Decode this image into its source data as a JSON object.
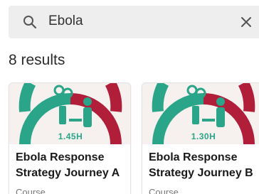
{
  "search": {
    "query": "Ebola",
    "search_icon": "search-icon",
    "clear_icon": "close-icon"
  },
  "results": {
    "count_label": "8 results"
  },
  "cards": [
    {
      "title": "Ebola Response Strategy Journey A",
      "duration": "1.45H",
      "type": "Course",
      "icon": "health-worker-illustration"
    },
    {
      "title": "Ebola Response Strategy Journey B",
      "duration": "1.30H",
      "type": "Course",
      "icon": "health-worker-illustration"
    }
  ],
  "colors": {
    "accent_teal": "#2aa58a",
    "accent_red": "#b01e3a",
    "search_bg": "#eeeeee"
  }
}
